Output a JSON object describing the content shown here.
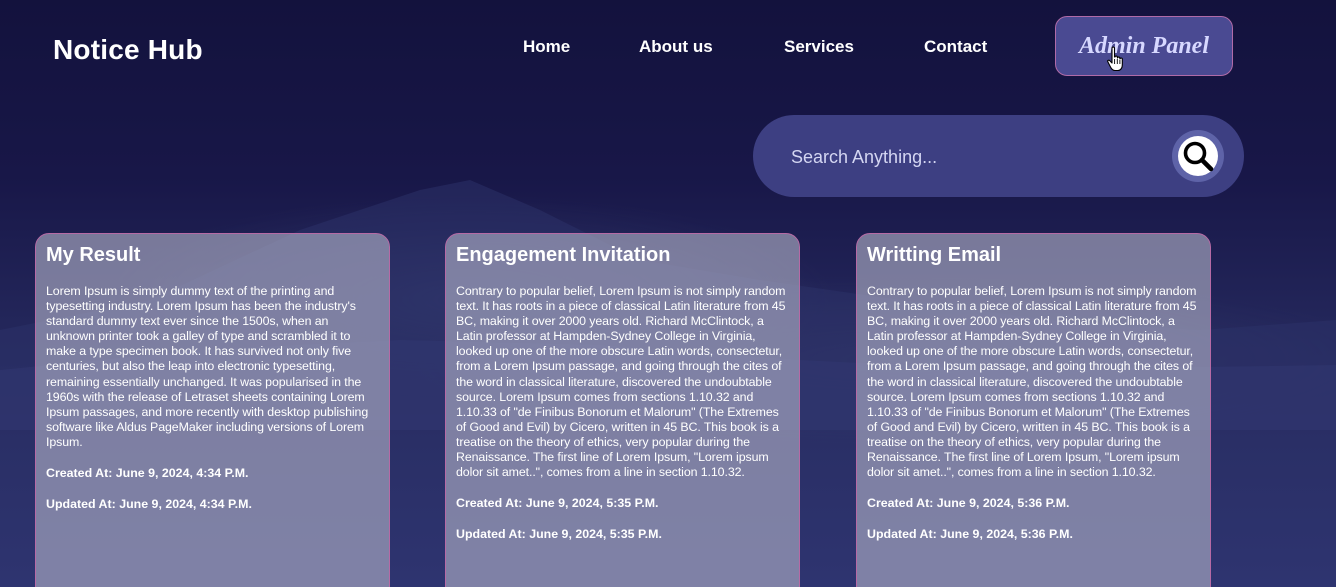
{
  "brand": {
    "title": "Notice Hub"
  },
  "nav": {
    "items": [
      {
        "label": "Home"
      },
      {
        "label": "About us"
      },
      {
        "label": "Services"
      },
      {
        "label": "Contact"
      }
    ],
    "admin_label": "Admin Panel"
  },
  "search": {
    "placeholder": "Search Anything...",
    "value": "",
    "icon": "search-icon"
  },
  "cards": [
    {
      "title": "My Result",
      "body": "Lorem Ipsum is simply dummy text of the printing and typesetting industry. Lorem Ipsum has been the industry's standard dummy text ever since the 1500s, when an unknown printer took a galley of type and scrambled it to make a type specimen book. It has survived not only five centuries, but also the leap into electronic typesetting, remaining essentially unchanged. It was popularised in the 1960s with the release of Letraset sheets containing Lorem Ipsum passages, and more recently with desktop publishing software like Aldus PageMaker including versions of Lorem Ipsum.",
      "created": "Created At: June 9, 2024, 4:34 P.M.",
      "updated": "Updated At: June 9, 2024, 4:34 P.M."
    },
    {
      "title": "Engagement Invitation",
      "body": "Contrary to popular belief, Lorem Ipsum is not simply random text. It has roots in a piece of classical Latin literature from 45 BC, making it over 2000 years old. Richard McClintock, a Latin professor at Hampden-Sydney College in Virginia, looked up one of the more obscure Latin words, consectetur, from a Lorem Ipsum passage, and going through the cites of the word in classical literature, discovered the undoubtable source. Lorem Ipsum comes from sections 1.10.32 and 1.10.33 of \"de Finibus Bonorum et Malorum\" (The Extremes of Good and Evil) by Cicero, written in 45 BC. This book is a treatise on the theory of ethics, very popular during the Renaissance. The first line of Lorem Ipsum, \"Lorem ipsum dolor sit amet..\", comes from a line in section 1.10.32.",
      "created": "Created At: June 9, 2024, 5:35 P.M.",
      "updated": "Updated At: June 9, 2024, 5:35 P.M."
    },
    {
      "title": "Writting Email",
      "body": "Contrary to popular belief, Lorem Ipsum is not simply random text. It has roots in a piece of classical Latin literature from 45 BC, making it over 2000 years old. Richard McClintock, a Latin professor at Hampden-Sydney College in Virginia, looked up one of the more obscure Latin words, consectetur, from a Lorem Ipsum passage, and going through the cites of the word in classical literature, discovered the undoubtable source. Lorem Ipsum comes from sections 1.10.32 and 1.10.33 of \"de Finibus Bonorum et Malorum\" (The Extremes of Good and Evil) by Cicero, written in 45 BC. This book is a treatise on the theory of ethics, very popular during the Renaissance. The first line of Lorem Ipsum, \"Lorem ipsum dolor sit amet..\", comes from a line in section 1.10.32.",
      "created": "Created At: June 9, 2024, 5:36 P.M.",
      "updated": "Updated At: June 9, 2024, 5:36 P.M."
    }
  ],
  "colors": {
    "accent": "#4a4a92",
    "card_border": "#b66aa5",
    "admin_text": "#d7d8ff",
    "background_top": "#13123d",
    "background_bottom": "#2e3470"
  }
}
